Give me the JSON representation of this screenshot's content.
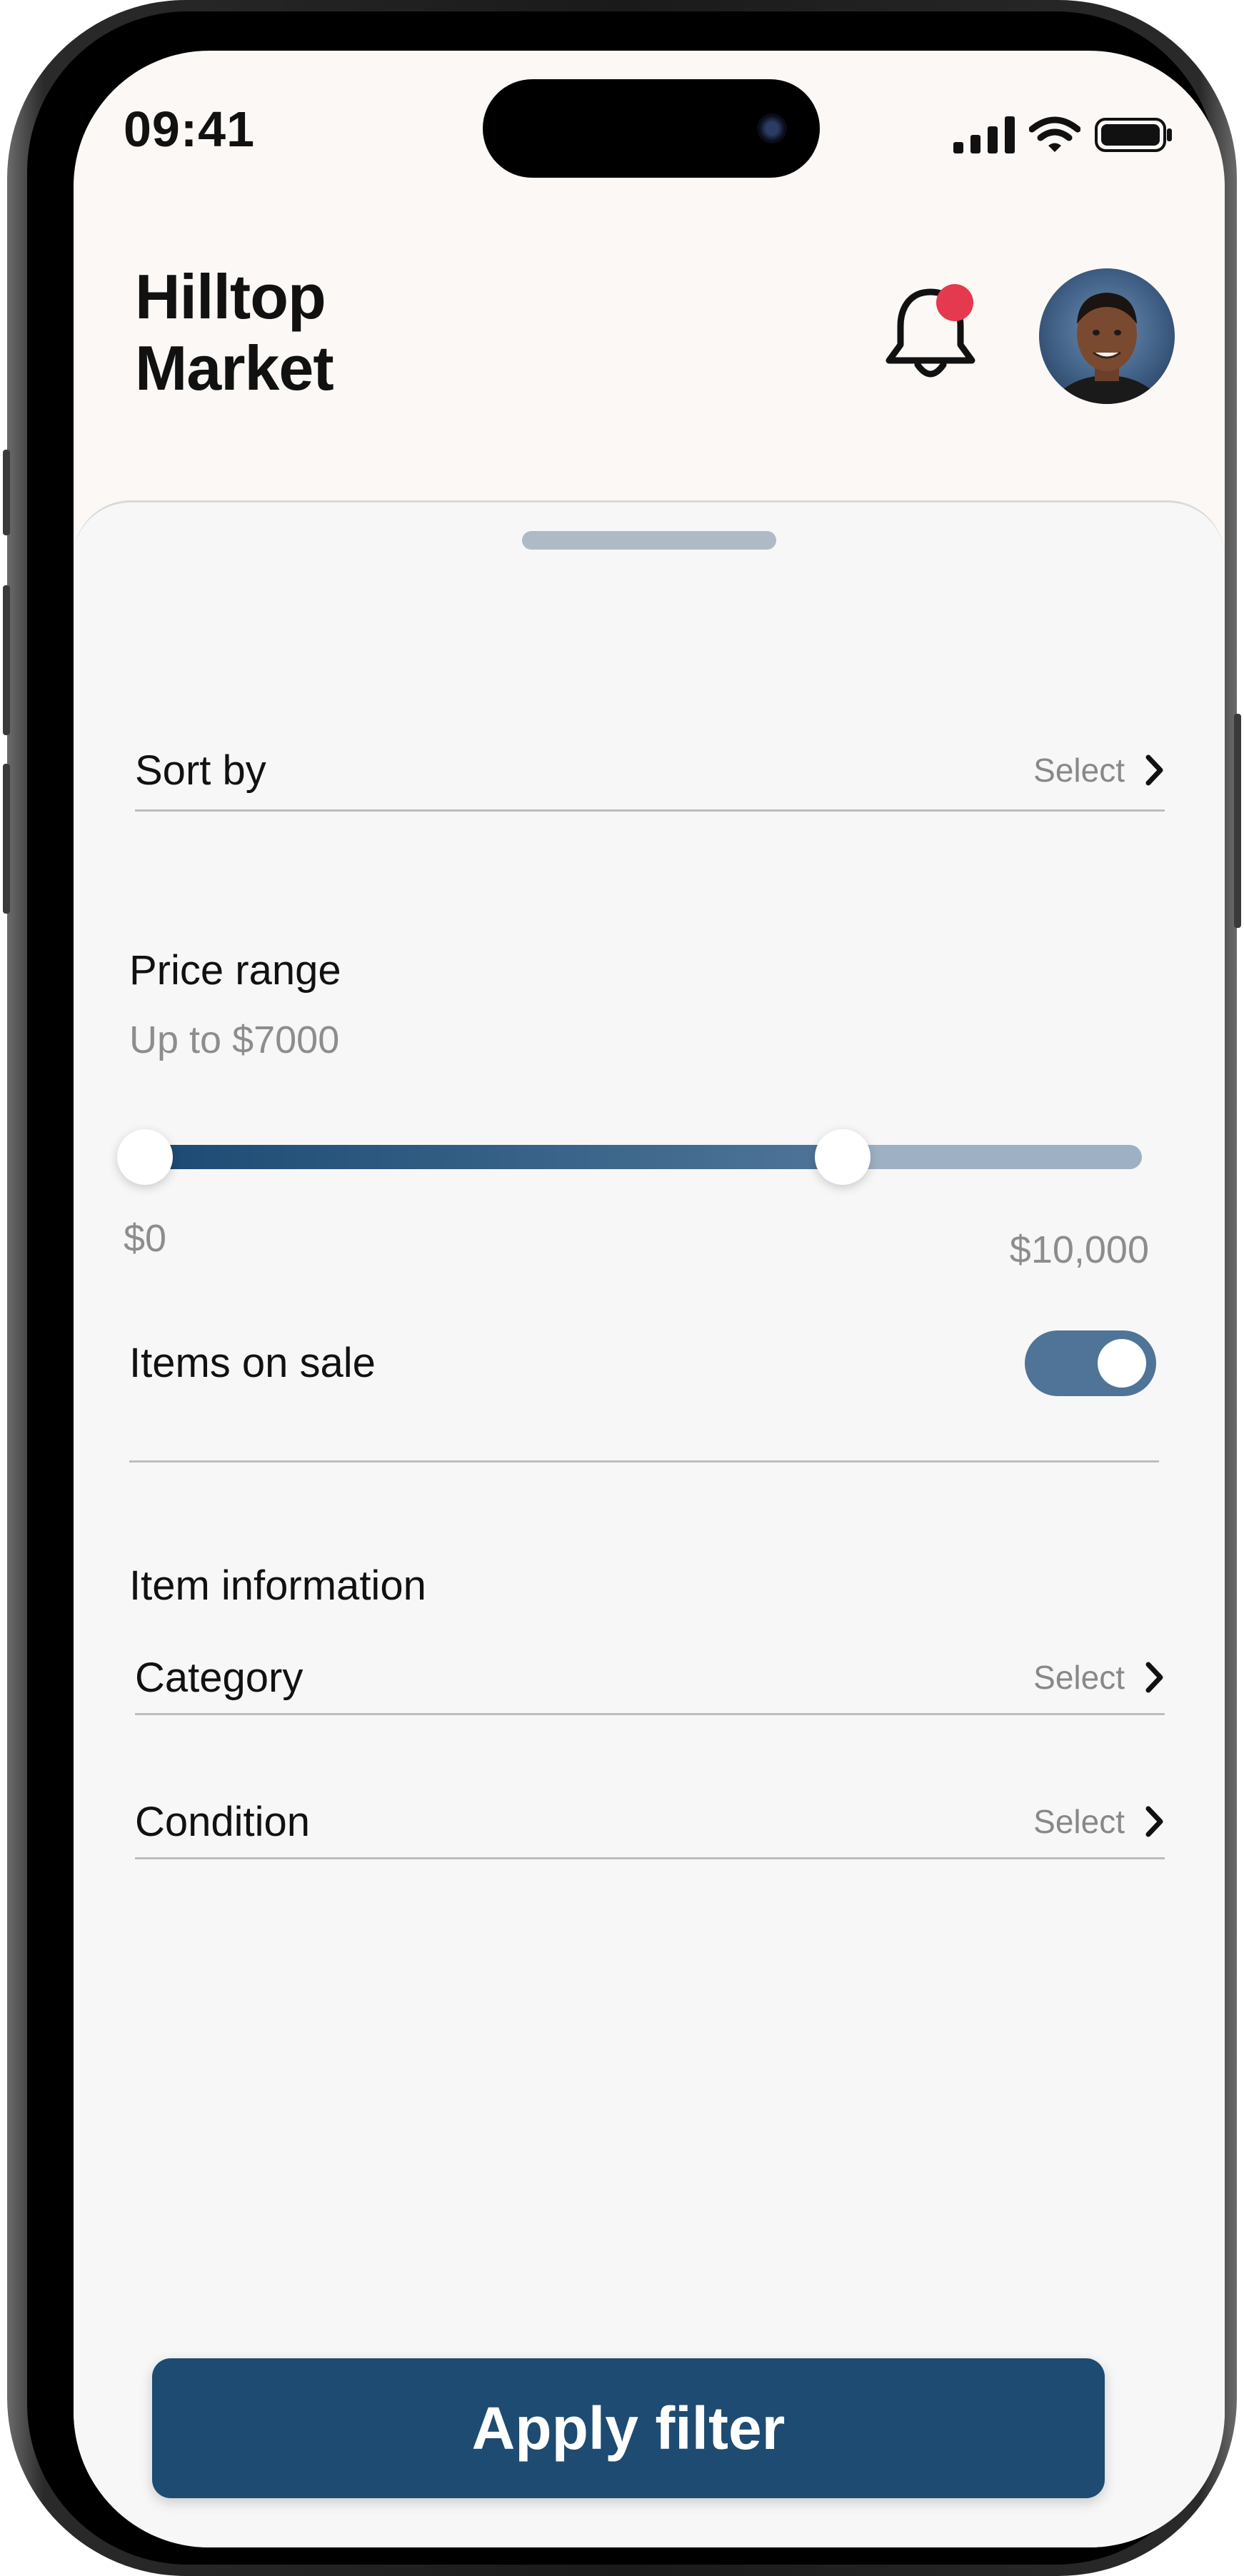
{
  "status_bar": {
    "time": "09:41"
  },
  "header": {
    "title_line1": "Hilltop",
    "title_line2": "Market"
  },
  "sort": {
    "label": "Sort by",
    "select": "Select"
  },
  "price": {
    "title": "Price range",
    "subtitle": "Up to $7000",
    "min_label": "$0",
    "max_label": "$10,000",
    "min": 0,
    "max": 10000,
    "low_value": 0,
    "high_value": 7000
  },
  "sale": {
    "label": "Items on sale",
    "on": true
  },
  "item_info": {
    "title": "Item information",
    "rows": [
      {
        "label": "Category",
        "select": "Select"
      },
      {
        "label": "Condition",
        "select": "Select"
      }
    ]
  },
  "apply_label": "Apply filter",
  "colors": {
    "accent": "#1e4b71",
    "notification": "#e4394f",
    "toggle": "#4f7497"
  }
}
